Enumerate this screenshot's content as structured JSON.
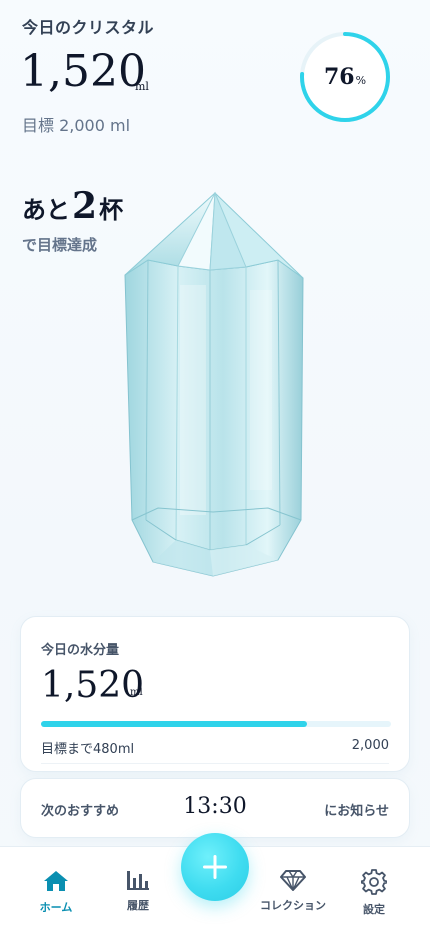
{
  "header": {
    "title": "今日のクリスタル",
    "amount": "1,520",
    "unit": "ml",
    "goal_text": "目標 2,000 ml"
  },
  "progress": {
    "percent_value": "76",
    "percent_sign": "%",
    "fraction": 0.76,
    "ring_color": "#2fd3ea"
  },
  "remaining": {
    "prefix": "あと",
    "number": "2",
    "suffix": "杯",
    "subtitle": "で目標達成"
  },
  "crystal": {
    "icon": "crystal-illustration",
    "color": "#a9dde6"
  },
  "intake_card": {
    "label": "今日の水分量",
    "amount": "1,520",
    "unit": "ml",
    "bar_fraction": 0.76,
    "remaining_text": "目標まで480ml",
    "goal_max": "2,000"
  },
  "recommendation": {
    "label": "次のおすすめ",
    "time": "13:30",
    "notify": "にお知らせ"
  },
  "nav": {
    "home": {
      "label": "ホーム",
      "icon": "home-icon",
      "active": true
    },
    "history": {
      "label": "履歴",
      "icon": "bar-chart-icon"
    },
    "add": {
      "icon": "plus-icon"
    },
    "collection": {
      "label": "コレクション",
      "icon": "diamond-icon"
    },
    "settings": {
      "label": "設定",
      "icon": "gear-icon"
    }
  },
  "colors": {
    "accent": "#2fd3ea",
    "active_nav": "#0a8fb1",
    "text_muted": "#64748b"
  }
}
